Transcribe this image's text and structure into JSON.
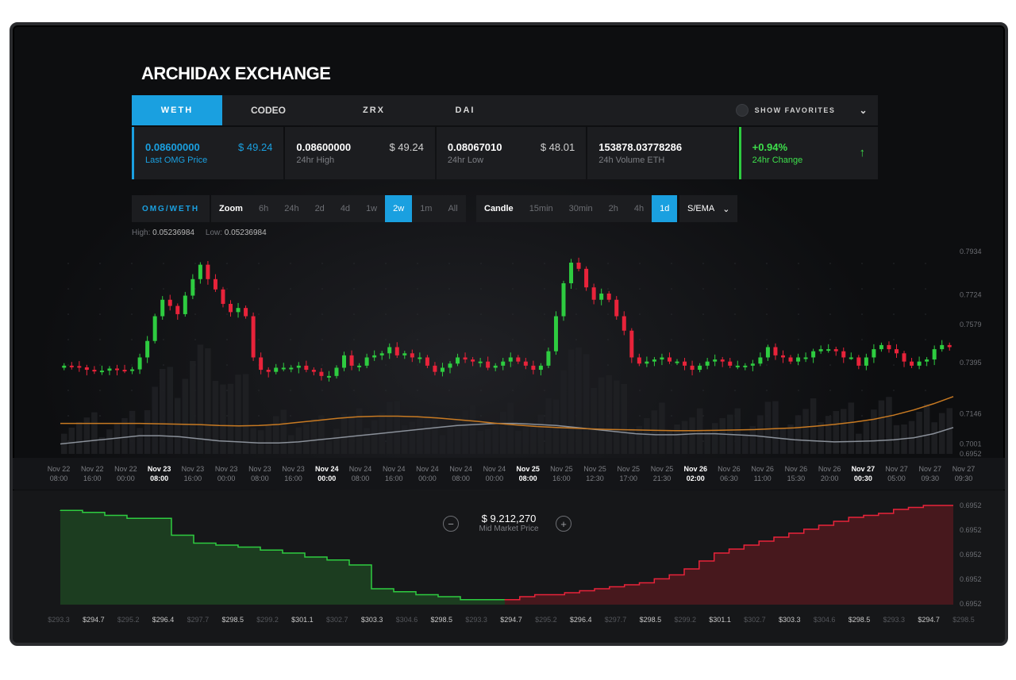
{
  "brand": "ARCHIDAX EXCHANGE",
  "tabs": [
    "WETH",
    "CODEO",
    "ZRX",
    "DAI"
  ],
  "active_tab": "WETH",
  "show_favorites": "SHOW FAVORITES",
  "stats": {
    "last_price": {
      "value": "0.08600000",
      "usd": "$ 49.24",
      "label": "Last OMG Price"
    },
    "high": {
      "value": "0.08600000",
      "usd": "$ 49.24",
      "label": "24hr High"
    },
    "low": {
      "value": "0.08067010",
      "usd": "$ 48.01",
      "label": "24hr Low"
    },
    "volume": {
      "value": "153878.03778286",
      "label": "24h Volume ETH"
    },
    "change": {
      "value": "+0.94%",
      "label": "24hr Change"
    }
  },
  "pair": "OMG/WETH",
  "zoom": {
    "label": "Zoom",
    "options": [
      "6h",
      "24h",
      "2d",
      "4d",
      "1w",
      "2w",
      "1m",
      "All"
    ],
    "selected": "2w"
  },
  "candle": {
    "label": "Candle",
    "options": [
      "15min",
      "30min",
      "2h",
      "4h",
      "1d"
    ],
    "selected": "1d"
  },
  "indicator": "S/EMA",
  "high_low": {
    "high_label": "High:",
    "high": "0.05236984",
    "low_label": "Low:",
    "low": "0.05236984"
  },
  "mid_market": {
    "value": "$ 9.212,270",
    "label": "Mid Market Price"
  },
  "colors": {
    "accent": "#1aa0e0",
    "up": "#2ecc40",
    "down": "#e8233a",
    "ema": "#c87a22",
    "sma": "#8a9099"
  },
  "chart_data": [
    {
      "type": "candlestick",
      "y_ticks": [
        "0.7934",
        "0.7724",
        "0.7579",
        "0.7395",
        "0.7146",
        "0.7001",
        "0.6952"
      ],
      "ylim": [
        0.6952,
        0.7934
      ],
      "x_ticks": [
        {
          "date": "Nov 22",
          "time": "08:00",
          "bold": false
        },
        {
          "date": "Nov 22",
          "time": "16:00",
          "bold": false
        },
        {
          "date": "Nov 22",
          "time": "00:00",
          "bold": false
        },
        {
          "date": "Nov 23",
          "time": "08:00",
          "bold": true
        },
        {
          "date": "Nov 23",
          "time": "16:00",
          "bold": false
        },
        {
          "date": "Nov 23",
          "time": "00:00",
          "bold": false
        },
        {
          "date": "Nov 23",
          "time": "08:00",
          "bold": false
        },
        {
          "date": "Nov 23",
          "time": "16:00",
          "bold": false
        },
        {
          "date": "Nov 24",
          "time": "00:00",
          "bold": true
        },
        {
          "date": "Nov 24",
          "time": "08:00",
          "bold": false
        },
        {
          "date": "Nov 24",
          "time": "16:00",
          "bold": false
        },
        {
          "date": "Nov 24",
          "time": "00:00",
          "bold": false
        },
        {
          "date": "Nov 24",
          "time": "08:00",
          "bold": false
        },
        {
          "date": "Nov 24",
          "time": "00:00",
          "bold": false
        },
        {
          "date": "Nov 25",
          "time": "08:00",
          "bold": true
        },
        {
          "date": "Nov 25",
          "time": "16:00",
          "bold": false
        },
        {
          "date": "Nov 25",
          "time": "12:30",
          "bold": false
        },
        {
          "date": "Nov 25",
          "time": "17:00",
          "bold": false
        },
        {
          "date": "Nov 25",
          "time": "21:30",
          "bold": false
        },
        {
          "date": "Nov 26",
          "time": "02:00",
          "bold": true
        },
        {
          "date": "Nov 26",
          "time": "06:30",
          "bold": false
        },
        {
          "date": "Nov 26",
          "time": "11:00",
          "bold": false
        },
        {
          "date": "Nov 26",
          "time": "15:30",
          "bold": false
        },
        {
          "date": "Nov 26",
          "time": "20:00",
          "bold": false
        },
        {
          "date": "Nov 27",
          "time": "00:30",
          "bold": true
        },
        {
          "date": "Nov 27",
          "time": "05:00",
          "bold": false
        },
        {
          "date": "Nov 27",
          "time": "09:30",
          "bold": false
        },
        {
          "date": "Nov 27",
          "time": "09:30",
          "bold": false
        }
      ],
      "close": [
        0.738,
        0.7378,
        0.7372,
        0.736,
        0.7352,
        0.7356,
        0.7366,
        0.736,
        0.7356,
        0.7362,
        0.742,
        0.75,
        0.762,
        0.77,
        0.767,
        0.763,
        0.772,
        0.78,
        0.787,
        0.78,
        0.775,
        0.768,
        0.764,
        0.766,
        0.762,
        0.742,
        0.736,
        0.735,
        0.737,
        0.737,
        0.737,
        0.738,
        0.736,
        0.735,
        0.733,
        0.733,
        0.737,
        0.743,
        0.738,
        0.738,
        0.742,
        0.743,
        0.744,
        0.747,
        0.743,
        0.744,
        0.742,
        0.742,
        0.738,
        0.735,
        0.737,
        0.739,
        0.742,
        0.741,
        0.74,
        0.74,
        0.737,
        0.738,
        0.74,
        0.742,
        0.74,
        0.738,
        0.736,
        0.738,
        0.745,
        0.762,
        0.778,
        0.788,
        0.785,
        0.776,
        0.77,
        0.773,
        0.77,
        0.762,
        0.755,
        0.742,
        0.739,
        0.74,
        0.741,
        0.742,
        0.74,
        0.74,
        0.738,
        0.736,
        0.738,
        0.74,
        0.741,
        0.74,
        0.738,
        0.738,
        0.738,
        0.739,
        0.742,
        0.747,
        0.743,
        0.742,
        0.74,
        0.742,
        0.742,
        0.745,
        0.746,
        0.746,
        0.745,
        0.742,
        0.742,
        0.738,
        0.742,
        0.746,
        0.748,
        0.746,
        0.744,
        0.74,
        0.738,
        0.74,
        0.741,
        0.746,
        0.748,
        0.747
      ],
      "sma": [
        0.7,
        0.701,
        0.702,
        0.703,
        0.704,
        0.704,
        0.7035,
        0.7025,
        0.7015,
        0.701,
        0.7005,
        0.7005,
        0.701,
        0.702,
        0.703,
        0.704,
        0.705,
        0.706,
        0.707,
        0.708,
        0.709,
        0.7095,
        0.71,
        0.71,
        0.7095,
        0.709,
        0.708,
        0.707,
        0.706,
        0.705,
        0.7045,
        0.7045,
        0.705,
        0.705,
        0.7045,
        0.704,
        0.703,
        0.702,
        0.7015,
        0.701,
        0.7012,
        0.7015,
        0.702,
        0.703,
        0.705,
        0.708
      ],
      "ema": [
        0.71,
        0.71,
        0.71,
        0.71,
        0.71,
        0.7098,
        0.7096,
        0.7094,
        0.709,
        0.7088,
        0.709,
        0.7095,
        0.7105,
        0.7115,
        0.7125,
        0.7132,
        0.7135,
        0.7135,
        0.7132,
        0.7126,
        0.7118,
        0.711,
        0.71,
        0.7092,
        0.7085,
        0.708,
        0.7076,
        0.7072,
        0.707,
        0.7068,
        0.7066,
        0.7065,
        0.7065,
        0.7066,
        0.7068,
        0.707,
        0.7074,
        0.7078,
        0.7086,
        0.7095,
        0.7106,
        0.712,
        0.714,
        0.7165,
        0.7195,
        0.723
      ]
    },
    {
      "type": "area",
      "title": "depth",
      "y_ticks": [
        "0.6952",
        "0.6952",
        "0.6952",
        "0.6952",
        "0.6952"
      ],
      "x_ticks": [
        "$293.3",
        "$294.7",
        "$295.2",
        "$296.4",
        "$297.7",
        "$298.5",
        "$299.2",
        "$301.1",
        "$302.7",
        "$303.3",
        "$304.6",
        "$298.5",
        "$293.3",
        "$294.7",
        "$295.2",
        "$296.4",
        "$297.7",
        "$298.5",
        "$299.2",
        "$301.1",
        "$302.7",
        "$303.3",
        "$304.6",
        "$298.5",
        "$293.3",
        "$294.7",
        "$298.5"
      ],
      "bids": [
        0.95,
        0.95,
        0.93,
        0.93,
        0.9,
        0.9,
        0.87,
        0.87,
        0.87,
        0.87,
        0.7,
        0.7,
        0.62,
        0.62,
        0.6,
        0.6,
        0.58,
        0.58,
        0.55,
        0.55,
        0.52,
        0.52,
        0.48,
        0.48,
        0.45,
        0.45,
        0.4,
        0.4,
        0.16,
        0.16,
        0.13,
        0.13,
        0.1,
        0.1,
        0.08,
        0.08,
        0.05,
        0.05,
        0.05,
        0.05
      ],
      "asks": [
        0.05,
        0.08,
        0.1,
        0.1,
        0.12,
        0.14,
        0.16,
        0.18,
        0.2,
        0.22,
        0.26,
        0.3,
        0.36,
        0.44,
        0.52,
        0.56,
        0.6,
        0.64,
        0.68,
        0.72,
        0.76,
        0.8,
        0.84,
        0.88,
        0.9,
        0.92,
        0.96,
        0.98,
        1.0,
        1.0
      ]
    }
  ]
}
